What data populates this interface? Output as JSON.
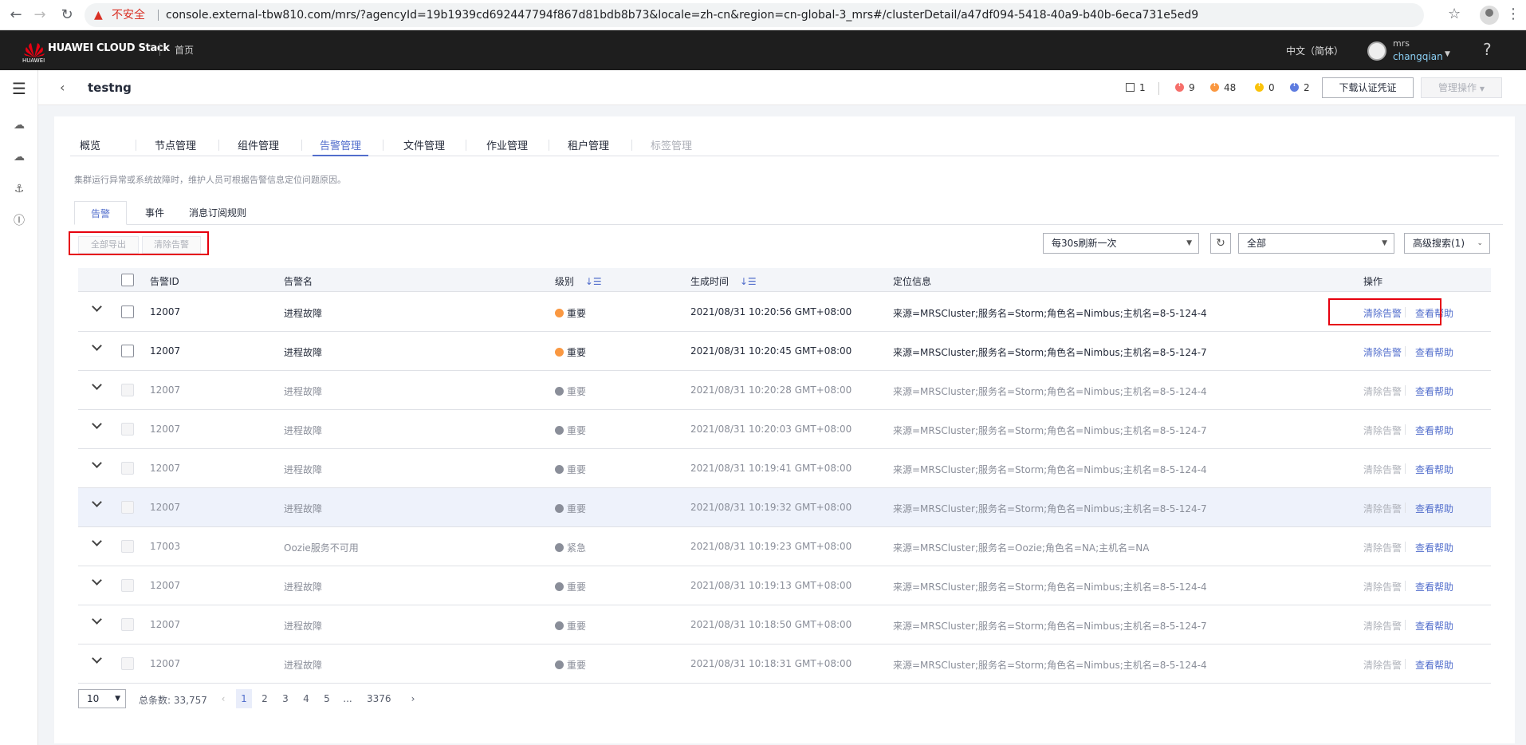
{
  "browser": {
    "insecure_label": "不安全",
    "url": "console.external-tbw810.com/mrs/?agencyId=19b1939cd692447794f867d81bdb8b73&locale=zh-cn&region=cn-global-3_mrs#/clusterDetail/a47df094-5418-40a9-b40b-6eca731e5ed9"
  },
  "header": {
    "brand": "HUAWEI CLOUD Stack",
    "brand_sub": "HUAWEI",
    "home": "首页",
    "language": "中文（简体）",
    "user_top": "mrs",
    "user_name": "changqian",
    "help": "?"
  },
  "title_bar": {
    "title": "testng",
    "stats": [
      {
        "name": "hosts",
        "value": "1",
        "color": "#555555"
      },
      {
        "name": "critical",
        "value": "9",
        "color": "#f66f6a"
      },
      {
        "name": "major",
        "value": "48",
        "color": "#fa9841"
      },
      {
        "name": "minor",
        "value": "0",
        "color": "#fac20a"
      },
      {
        "name": "warning",
        "value": "2",
        "color": "#5e7ce0"
      }
    ],
    "download_btn": "下载认证凭证",
    "manage_btn": "管理操作"
  },
  "tabs": [
    "概览",
    "节点管理",
    "组件管理",
    "告警管理",
    "文件管理",
    "作业管理",
    "租户管理",
    "标签管理"
  ],
  "description": "集群运行异常或系统故障时，维护人员可根据告警信息定位问题原因。",
  "subtabs": [
    "告警",
    "事件",
    "消息订阅规则"
  ],
  "toolbar": {
    "export_all": "全部导出",
    "clear_alarm": "清除告警",
    "refresh_interval": "每30s刷新一次",
    "filter": "全部",
    "advanced_search": "高级搜索(1)"
  },
  "table": {
    "columns": [
      "告警ID",
      "告警名",
      "级别",
      "生成时间",
      "定位信息",
      "操作"
    ],
    "rows": [
      {
        "id": "12007",
        "name": "进程故障",
        "level": "重要",
        "time": "2021/08/31 10:20:56 GMT+08:00",
        "location": "来源=MRSCluster;服务名=Storm;角色名=Nimbus;主机名=8-5-124-4",
        "clear": "清除告警",
        "help": "查看帮助"
      },
      {
        "id": "12007",
        "name": "进程故障",
        "level": "重要",
        "time": "2021/08/31 10:20:45 GMT+08:00",
        "location": "来源=MRSCluster;服务名=Storm;角色名=Nimbus;主机名=8-5-124-7",
        "clear": "清除告警",
        "help": "查看帮助"
      },
      {
        "id": "12007",
        "name": "进程故障",
        "level": "重要",
        "time": "2021/08/31 10:20:28 GMT+08:00",
        "location": "来源=MRSCluster;服务名=Storm;角色名=Nimbus;主机名=8-5-124-4",
        "clear": "清除告警",
        "help": "查看帮助"
      },
      {
        "id": "12007",
        "name": "进程故障",
        "level": "重要",
        "time": "2021/08/31 10:20:03 GMT+08:00",
        "location": "来源=MRSCluster;服务名=Storm;角色名=Nimbus;主机名=8-5-124-7",
        "clear": "清除告警",
        "help": "查看帮助"
      },
      {
        "id": "12007",
        "name": "进程故障",
        "level": "重要",
        "time": "2021/08/31 10:19:41 GMT+08:00",
        "location": "来源=MRSCluster;服务名=Storm;角色名=Nimbus;主机名=8-5-124-4",
        "clear": "清除告警",
        "help": "查看帮助"
      },
      {
        "id": "12007",
        "name": "进程故障",
        "level": "重要",
        "time": "2021/08/31 10:19:32 GMT+08:00",
        "location": "来源=MRSCluster;服务名=Storm;角色名=Nimbus;主机名=8-5-124-7",
        "clear": "清除告警",
        "help": "查看帮助"
      },
      {
        "id": "17003",
        "name": "Oozie服务不可用",
        "level": "紧急",
        "time": "2021/08/31 10:19:23 GMT+08:00",
        "location": "来源=MRSCluster;服务名=Oozie;角色名=NA;主机名=NA",
        "clear": "清除告警",
        "help": "查看帮助"
      },
      {
        "id": "12007",
        "name": "进程故障",
        "level": "重要",
        "time": "2021/08/31 10:19:13 GMT+08:00",
        "location": "来源=MRSCluster;服务名=Storm;角色名=Nimbus;主机名=8-5-124-4",
        "clear": "清除告警",
        "help": "查看帮助"
      },
      {
        "id": "12007",
        "name": "进程故障",
        "level": "重要",
        "time": "2021/08/31 10:18:50 GMT+08:00",
        "location": "来源=MRSCluster;服务名=Storm;角色名=Nimbus;主机名=8-5-124-7",
        "clear": "清除告警",
        "help": "查看帮助"
      },
      {
        "id": "12007",
        "name": "进程故障",
        "level": "重要",
        "time": "2021/08/31 10:18:31 GMT+08:00",
        "location": "来源=MRSCluster;服务名=Storm;角色名=Nimbus;主机名=8-5-124-4",
        "clear": "清除告警",
        "help": "查看帮助"
      }
    ]
  },
  "pagination": {
    "page_size": "10",
    "total": "总条数: 33,757",
    "pages": [
      "1",
      "2",
      "3",
      "4",
      "5",
      "...",
      "3376"
    ],
    "prev": "‹",
    "next": "›"
  },
  "colors": {
    "accent": "#526ecc",
    "major": "#fa9841",
    "disabled": "#8a8e99",
    "highlight_box": "#e6000e"
  }
}
